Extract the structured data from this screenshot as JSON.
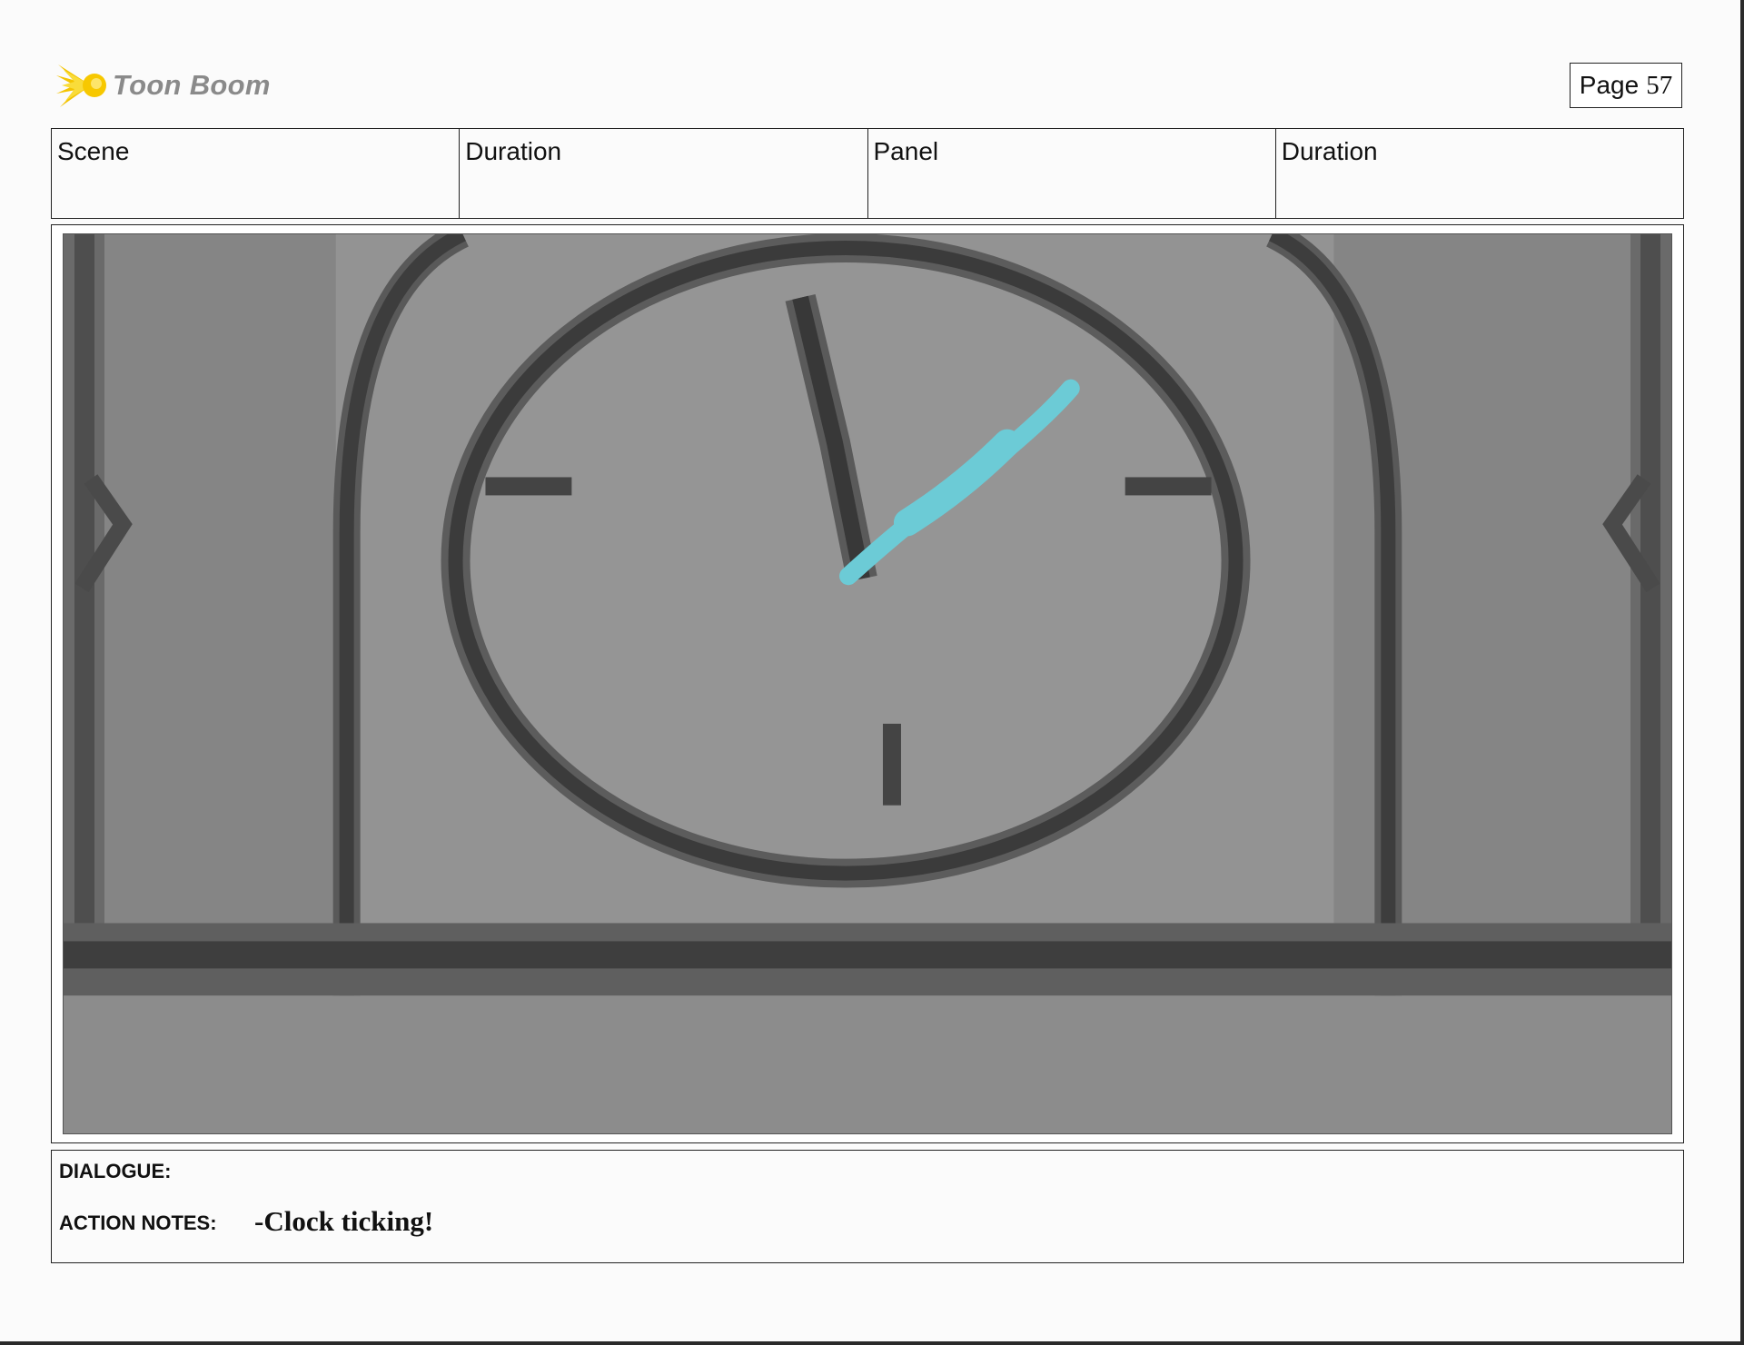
{
  "logo": {
    "text": "Toon Boom",
    "icon": "starburst-icon",
    "accent": "#f4c400"
  },
  "page": {
    "label": "Page",
    "number": "57"
  },
  "header": {
    "cells": [
      {
        "label": "Scene",
        "value": ""
      },
      {
        "label": "Duration",
        "value": ""
      },
      {
        "label": "Panel",
        "value": ""
      },
      {
        "label": "Duration",
        "value": ""
      }
    ]
  },
  "panel": {
    "image": "pixelated-clock-sketch",
    "stroke_color": "#6ccbd6"
  },
  "notes": {
    "dialogue_label": "DIALOGUE:",
    "dialogue_text": "",
    "action_label": "ACTION NOTES:",
    "action_text": "-Clock ticking!"
  }
}
